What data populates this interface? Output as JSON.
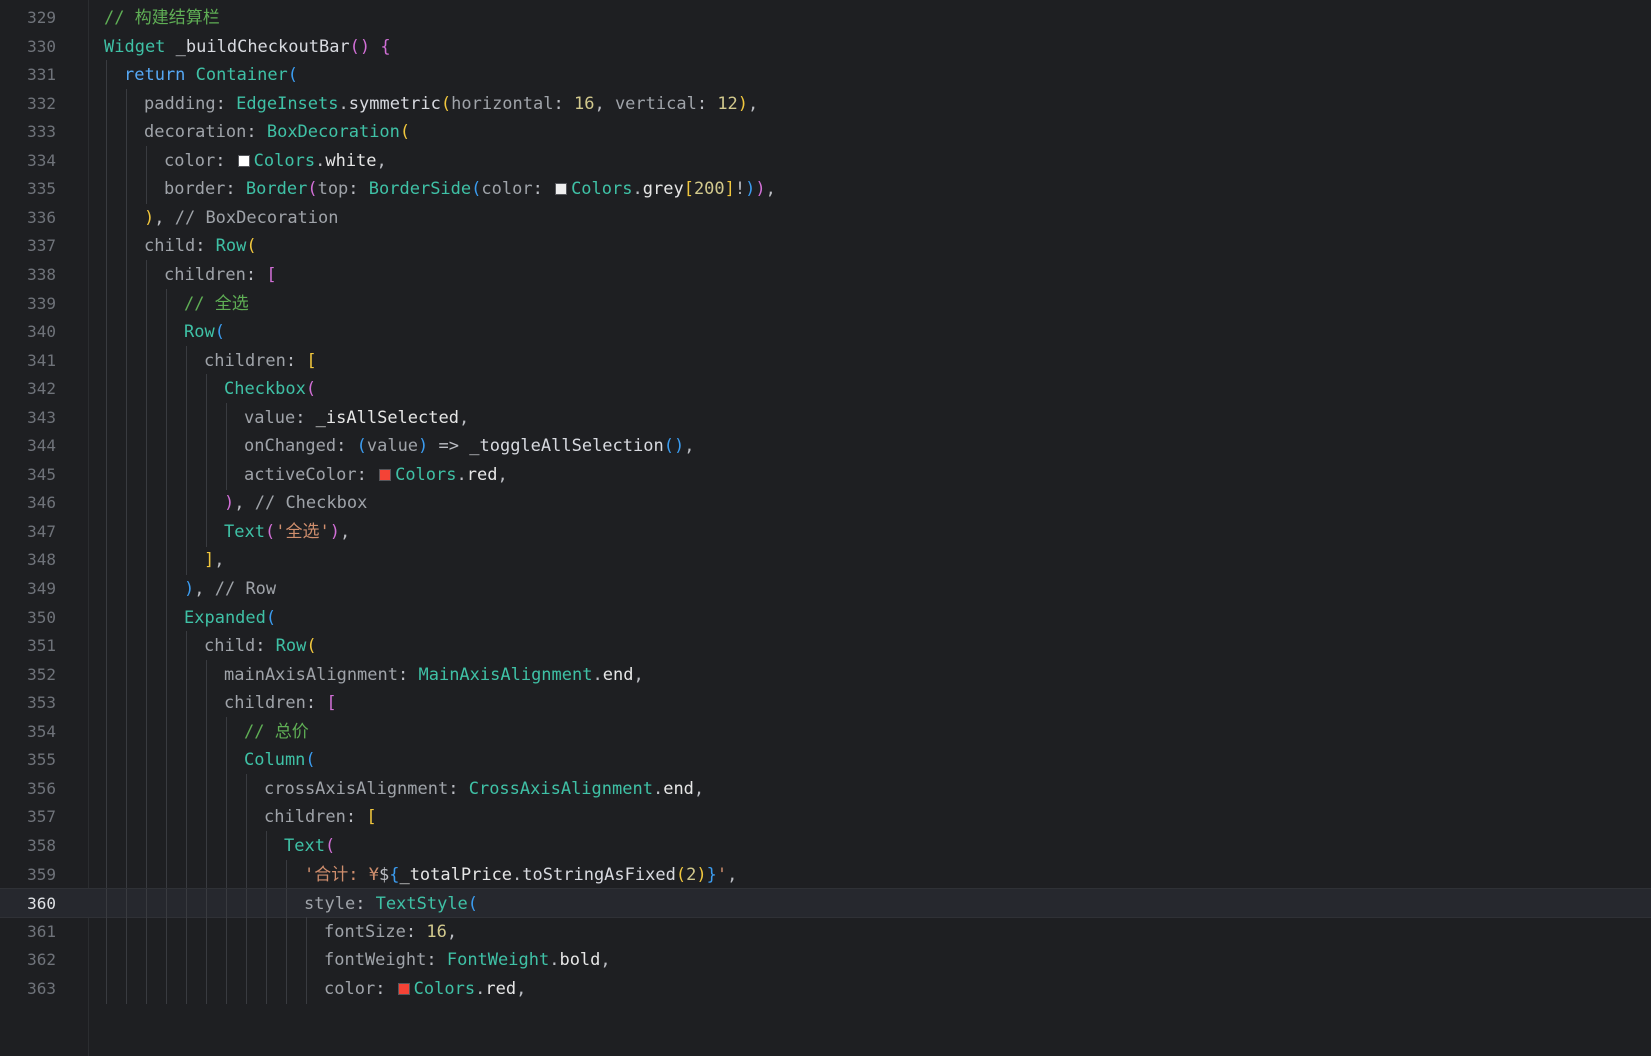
{
  "editor": {
    "current_line": 360,
    "colors": {
      "background": "#1e1f22",
      "current_line_bg": "#26282e",
      "comment": "#5fae55",
      "type": "#3fc1a6",
      "keyword": "#56a8f5",
      "string": "#cf8e6d",
      "number": "#d2c98d",
      "bracket_1": "#f0c63d",
      "bracket_2": "#d16fd6",
      "bracket_3": "#3b9cf0"
    },
    "lines": [
      {
        "n": "329",
        "indent": 0,
        "tokens": [
          [
            "c-comment",
            "// 构建结算栏"
          ]
        ]
      },
      {
        "n": "330",
        "indent": 0,
        "tokens": [
          [
            "c-type",
            "Widget"
          ],
          [
            "c-plain",
            " "
          ],
          [
            "c-fn",
            "_buildCheckoutBar"
          ],
          [
            "c-b2",
            "()"
          ],
          [
            "c-plain",
            " "
          ],
          [
            "c-b2",
            "{"
          ]
        ]
      },
      {
        "n": "331",
        "indent": 1,
        "tokens": [
          [
            "c-kw",
            "return"
          ],
          [
            "c-plain",
            " "
          ],
          [
            "c-type",
            "Container"
          ],
          [
            "c-b3",
            "("
          ]
        ]
      },
      {
        "n": "332",
        "indent": 2,
        "tokens": [
          [
            "c-param",
            "padding"
          ],
          [
            "c-plain",
            ": "
          ],
          [
            "c-type",
            "EdgeInsets"
          ],
          [
            "c-plain",
            "."
          ],
          [
            "c-fn",
            "symmetric"
          ],
          [
            "c-b1",
            "("
          ],
          [
            "c-param",
            "horizontal"
          ],
          [
            "c-plain",
            ": "
          ],
          [
            "c-num",
            "16"
          ],
          [
            "c-plain",
            ", "
          ],
          [
            "c-param",
            "vertical"
          ],
          [
            "c-plain",
            ": "
          ],
          [
            "c-num",
            "12"
          ],
          [
            "c-b1",
            ")"
          ],
          [
            "c-plain",
            ","
          ]
        ]
      },
      {
        "n": "333",
        "indent": 2,
        "tokens": [
          [
            "c-param",
            "decoration"
          ],
          [
            "c-plain",
            ": "
          ],
          [
            "c-type",
            "BoxDecoration"
          ],
          [
            "c-b1",
            "("
          ]
        ]
      },
      {
        "n": "334",
        "indent": 3,
        "tokens": [
          [
            "c-param",
            "color"
          ],
          [
            "c-plain",
            ": "
          ],
          [
            "swatch",
            "#ffffff"
          ],
          [
            "c-type",
            "Colors"
          ],
          [
            "c-plain",
            "."
          ],
          [
            "c-white",
            "white"
          ],
          [
            "c-plain",
            ","
          ]
        ]
      },
      {
        "n": "335",
        "indent": 3,
        "tokens": [
          [
            "c-param",
            "border"
          ],
          [
            "c-plain",
            ": "
          ],
          [
            "c-type",
            "Border"
          ],
          [
            "c-b2",
            "("
          ],
          [
            "c-param",
            "top"
          ],
          [
            "c-plain",
            ": "
          ],
          [
            "c-type",
            "BorderSide"
          ],
          [
            "c-b3",
            "("
          ],
          [
            "c-param",
            "color"
          ],
          [
            "c-plain",
            ": "
          ],
          [
            "swatch",
            "#eeeeee"
          ],
          [
            "c-type",
            "Colors"
          ],
          [
            "c-plain",
            "."
          ],
          [
            "c-white",
            "grey"
          ],
          [
            "c-b1",
            "["
          ],
          [
            "c-num",
            "200"
          ],
          [
            "c-b1",
            "]"
          ],
          [
            "c-plain",
            "!"
          ],
          [
            "c-b3",
            ")"
          ],
          [
            "c-b2",
            ")"
          ],
          [
            "c-plain",
            ","
          ]
        ]
      },
      {
        "n": "336",
        "indent": 2,
        "tokens": [
          [
            "c-b1",
            ")"
          ],
          [
            "c-plain",
            ", "
          ],
          [
            "c-ann",
            "// BoxDecoration"
          ]
        ]
      },
      {
        "n": "337",
        "indent": 2,
        "tokens": [
          [
            "c-param",
            "child"
          ],
          [
            "c-plain",
            ": "
          ],
          [
            "c-type",
            "Row"
          ],
          [
            "c-b1",
            "("
          ]
        ]
      },
      {
        "n": "338",
        "indent": 3,
        "tokens": [
          [
            "c-param",
            "children"
          ],
          [
            "c-plain",
            ": "
          ],
          [
            "c-b2",
            "["
          ]
        ]
      },
      {
        "n": "339",
        "indent": 4,
        "tokens": [
          [
            "c-comment",
            "// 全选"
          ]
        ]
      },
      {
        "n": "340",
        "indent": 4,
        "tokens": [
          [
            "c-type",
            "Row"
          ],
          [
            "c-b3",
            "("
          ]
        ]
      },
      {
        "n": "341",
        "indent": 5,
        "tokens": [
          [
            "c-param",
            "children"
          ],
          [
            "c-plain",
            ": "
          ],
          [
            "c-b1",
            "["
          ]
        ]
      },
      {
        "n": "342",
        "indent": 6,
        "tokens": [
          [
            "c-type",
            "Checkbox"
          ],
          [
            "c-b2",
            "("
          ]
        ]
      },
      {
        "n": "343",
        "indent": 7,
        "tokens": [
          [
            "c-param",
            "value"
          ],
          [
            "c-plain",
            ": "
          ],
          [
            "c-white",
            "_isAllSelected"
          ],
          [
            "c-plain",
            ","
          ]
        ]
      },
      {
        "n": "344",
        "indent": 7,
        "tokens": [
          [
            "c-param",
            "onChanged"
          ],
          [
            "c-plain",
            ": "
          ],
          [
            "c-b3",
            "("
          ],
          [
            "c-param",
            "value"
          ],
          [
            "c-b3",
            ")"
          ],
          [
            "c-plain",
            " => "
          ],
          [
            "c-fn",
            "_toggleAllSelection"
          ],
          [
            "c-b3",
            "()"
          ],
          [
            "c-plain",
            ","
          ]
        ]
      },
      {
        "n": "345",
        "indent": 7,
        "tokens": [
          [
            "c-param",
            "activeColor"
          ],
          [
            "c-plain",
            ": "
          ],
          [
            "swatch",
            "#f44336"
          ],
          [
            "c-type",
            "Colors"
          ],
          [
            "c-plain",
            "."
          ],
          [
            "c-white",
            "red"
          ],
          [
            "c-plain",
            ","
          ]
        ]
      },
      {
        "n": "346",
        "indent": 6,
        "tokens": [
          [
            "c-b2",
            ")"
          ],
          [
            "c-plain",
            ", "
          ],
          [
            "c-ann",
            "// Checkbox"
          ]
        ]
      },
      {
        "n": "347",
        "indent": 6,
        "tokens": [
          [
            "c-type",
            "Text"
          ],
          [
            "c-b2",
            "("
          ],
          [
            "c-str",
            "'全选'"
          ],
          [
            "c-b2",
            ")"
          ],
          [
            "c-plain",
            ","
          ]
        ]
      },
      {
        "n": "348",
        "indent": 5,
        "tokens": [
          [
            "c-b1",
            "]"
          ],
          [
            "c-plain",
            ","
          ]
        ]
      },
      {
        "n": "349",
        "indent": 4,
        "tokens": [
          [
            "c-b3",
            ")"
          ],
          [
            "c-plain",
            ", "
          ],
          [
            "c-ann",
            "// Row"
          ]
        ]
      },
      {
        "n": "350",
        "indent": 4,
        "tokens": [
          [
            "c-type",
            "Expanded"
          ],
          [
            "c-b3",
            "("
          ]
        ]
      },
      {
        "n": "351",
        "indent": 5,
        "tokens": [
          [
            "c-param",
            "child"
          ],
          [
            "c-plain",
            ": "
          ],
          [
            "c-type",
            "Row"
          ],
          [
            "c-b1",
            "("
          ]
        ]
      },
      {
        "n": "352",
        "indent": 6,
        "tokens": [
          [
            "c-param",
            "mainAxisAlignment"
          ],
          [
            "c-plain",
            ": "
          ],
          [
            "c-type",
            "MainAxisAlignment"
          ],
          [
            "c-plain",
            "."
          ],
          [
            "c-white",
            "end"
          ],
          [
            "c-plain",
            ","
          ]
        ]
      },
      {
        "n": "353",
        "indent": 6,
        "tokens": [
          [
            "c-param",
            "children"
          ],
          [
            "c-plain",
            ": "
          ],
          [
            "c-b2",
            "["
          ]
        ]
      },
      {
        "n": "354",
        "indent": 7,
        "tokens": [
          [
            "c-comment",
            "// 总价"
          ]
        ]
      },
      {
        "n": "355",
        "indent": 7,
        "tokens": [
          [
            "c-type",
            "Column"
          ],
          [
            "c-b3",
            "("
          ]
        ]
      },
      {
        "n": "356",
        "indent": 8,
        "tokens": [
          [
            "c-param",
            "crossAxisAlignment"
          ],
          [
            "c-plain",
            ": "
          ],
          [
            "c-type",
            "CrossAxisAlignment"
          ],
          [
            "c-plain",
            "."
          ],
          [
            "c-white",
            "end"
          ],
          [
            "c-plain",
            ","
          ]
        ]
      },
      {
        "n": "357",
        "indent": 8,
        "tokens": [
          [
            "c-param",
            "children"
          ],
          [
            "c-plain",
            ": "
          ],
          [
            "c-b1",
            "["
          ]
        ]
      },
      {
        "n": "358",
        "indent": 9,
        "tokens": [
          [
            "c-type",
            "Text"
          ],
          [
            "c-b2",
            "("
          ]
        ]
      },
      {
        "n": "359",
        "indent": 10,
        "tokens": [
          [
            "c-str",
            "'合计: ¥"
          ],
          [
            "c-plain",
            "$"
          ],
          [
            "c-b3",
            "{"
          ],
          [
            "c-white",
            "_totalPrice"
          ],
          [
            "c-plain",
            "."
          ],
          [
            "c-fn",
            "toStringAsFixed"
          ],
          [
            "c-b1",
            "("
          ],
          [
            "c-num",
            "2"
          ],
          [
            "c-b1",
            ")"
          ],
          [
            "c-b3",
            "}"
          ],
          [
            "c-str",
            "'"
          ],
          [
            "c-plain",
            ","
          ]
        ]
      },
      {
        "n": "360",
        "indent": 10,
        "tokens": [
          [
            "c-param",
            "style"
          ],
          [
            "c-plain",
            ": "
          ],
          [
            "c-type",
            "TextStyle"
          ],
          [
            "c-b3",
            "("
          ]
        ]
      },
      {
        "n": "361",
        "indent": 11,
        "tokens": [
          [
            "c-param",
            "fontSize"
          ],
          [
            "c-plain",
            ": "
          ],
          [
            "c-num",
            "16"
          ],
          [
            "c-plain",
            ","
          ]
        ]
      },
      {
        "n": "362",
        "indent": 11,
        "tokens": [
          [
            "c-param",
            "fontWeight"
          ],
          [
            "c-plain",
            ": "
          ],
          [
            "c-type",
            "FontWeight"
          ],
          [
            "c-plain",
            "."
          ],
          [
            "c-white",
            "bold"
          ],
          [
            "c-plain",
            ","
          ]
        ]
      },
      {
        "n": "363",
        "indent": 11,
        "tokens": [
          [
            "c-param",
            "color"
          ],
          [
            "c-plain",
            ": "
          ],
          [
            "swatch",
            "#f44336"
          ],
          [
            "c-type",
            "Colors"
          ],
          [
            "c-plain",
            "."
          ],
          [
            "c-white",
            "red"
          ],
          [
            "c-plain",
            ","
          ]
        ]
      }
    ]
  }
}
